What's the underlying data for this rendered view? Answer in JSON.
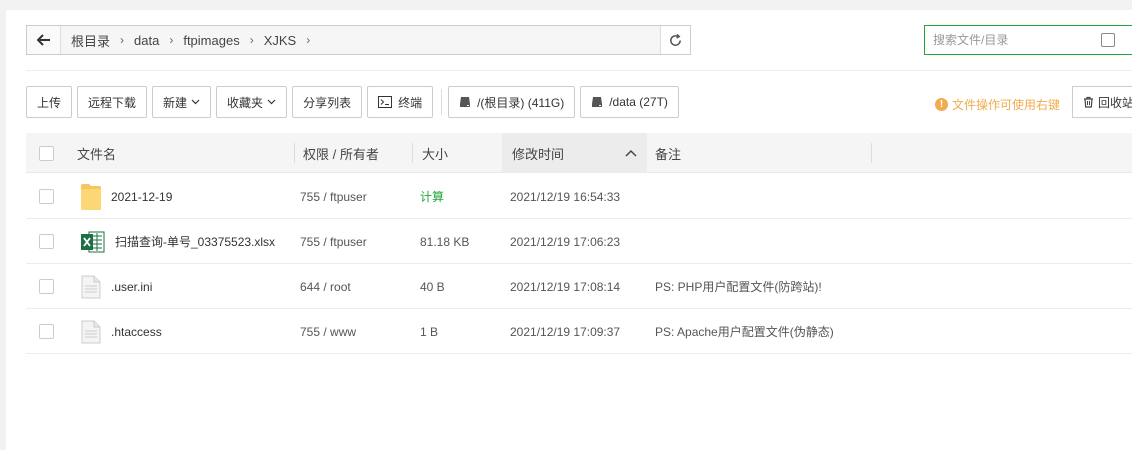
{
  "pathbar": {
    "crumbs": [
      "根目录",
      "data",
      "ftpimages",
      "XJKS"
    ]
  },
  "search": {
    "placeholder": "搜索文件/目录"
  },
  "toolbar": {
    "upload": "上传",
    "remote_download": "远程下载",
    "new": "新建",
    "favorites": "收藏夹",
    "share_list": "分享列表",
    "terminal": "终端",
    "disk_root": "/(根目录) (411G)",
    "disk_data": "/data (27T)"
  },
  "tip": {
    "text": "文件操作可使用右键",
    "icon": "!"
  },
  "recycle": {
    "label": "回收站"
  },
  "columns": {
    "name": "文件名",
    "perm": "权限 / 所有者",
    "size": "大小",
    "mtime": "修改时间",
    "note": "备注"
  },
  "files": [
    {
      "name": "2021-12-19",
      "icon": "folder-icon",
      "perm": "755 / ftpuser",
      "size": "计算",
      "mtime": "2021/12/19 16:54:33",
      "note": ""
    },
    {
      "name": "扫描查询-单号_03375523.xlsx",
      "icon": "excel-file-icon",
      "perm": "755 / ftpuser",
      "size": "81.18 KB",
      "mtime": "2021/12/19 17:06:23",
      "note": ""
    },
    {
      "name": ".user.ini",
      "icon": "text-file-icon",
      "perm": "644 / root",
      "size": "40 B",
      "mtime": "2021/12/19 17:08:14",
      "note": "PS: PHP用户配置文件(防跨站)!"
    },
    {
      "name": ".htaccess",
      "icon": "text-file-icon",
      "perm": "755 / www",
      "size": "1 B",
      "mtime": "2021/12/19 17:09:37",
      "note": "PS: Apache用户配置文件(伪静态)"
    }
  ],
  "colors": {
    "accent": "#20a53a",
    "warning": "#f0ad4e"
  }
}
